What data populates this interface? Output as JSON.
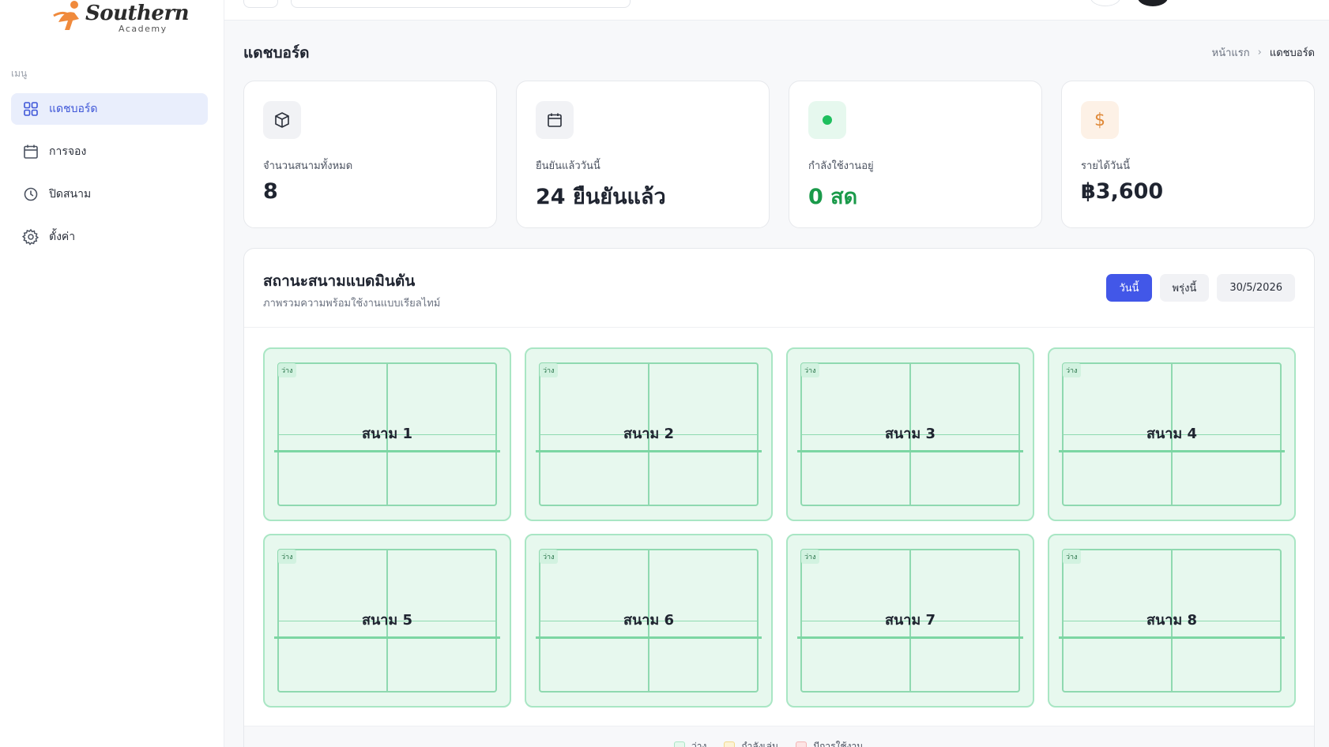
{
  "brand": {
    "name": "Southern",
    "sub": "Academy"
  },
  "sidebar": {
    "menu_label": "เมนู",
    "items": [
      {
        "label": "แดชบอร์ด",
        "icon": "grid-icon",
        "active": true
      },
      {
        "label": "การจอง",
        "icon": "calendar-icon",
        "active": false
      },
      {
        "label": "ปิดสนาม",
        "icon": "clock-icon",
        "active": false
      },
      {
        "label": "ตั้งค่า",
        "icon": "gear-icon",
        "active": false
      }
    ]
  },
  "header": {
    "title": "แดชบอร์ด",
    "breadcrumb": {
      "home": "หน้าแรก",
      "current": "แดชบอร์ด"
    }
  },
  "stats": [
    {
      "label": "จำนวนสนามทั้งหมด",
      "value": "8",
      "icon": "box-icon",
      "color": "#f1f2f5"
    },
    {
      "label": "ยืนยันแล้ววันนี้",
      "value": "24 ยืนยันแล้ว",
      "icon": "calendar-icon",
      "color": "#f1f2f5"
    },
    {
      "label": "กำลังใช้งานอยู่",
      "value": "0 สด",
      "icon": "dot-icon",
      "color": "#e6f8ee"
    },
    {
      "label": "รายได้วันนี้",
      "value": "฿3,600",
      "icon": "dollar-icon",
      "color": "#fdf1e6"
    }
  ],
  "panel": {
    "title": "สถานะสนามแบดมินตัน",
    "subtitle": "ภาพรวมความพร้อมใช้งานแบบเรียลไทม์",
    "filters": {
      "today": "วันนี้",
      "tomorrow": "พรุ่งนี้",
      "date": "30/5/2026"
    },
    "courts": [
      {
        "name": "สนาม 1",
        "status": "ว่าง"
      },
      {
        "name": "สนาม 2",
        "status": "ว่าง"
      },
      {
        "name": "สนาม 3",
        "status": "ว่าง"
      },
      {
        "name": "สนาม 4",
        "status": "ว่าง"
      },
      {
        "name": "สนาม 5",
        "status": "ว่าง"
      },
      {
        "name": "สนาม 6",
        "status": "ว่าง"
      },
      {
        "name": "สนาม 7",
        "status": "ว่าง"
      },
      {
        "name": "สนาม 8",
        "status": "ว่าง"
      }
    ],
    "legend": [
      {
        "label": "ว่าง",
        "color": "#e7f8ee"
      },
      {
        "label": "กำลังเล่น",
        "color": "#fdf3d6"
      },
      {
        "label": "มีการใช้งาน",
        "color": "#fde4e4"
      }
    ]
  },
  "colors": {
    "accent": "#4257e8",
    "available": "#a9e6c4",
    "live": "#1a9a4a"
  }
}
